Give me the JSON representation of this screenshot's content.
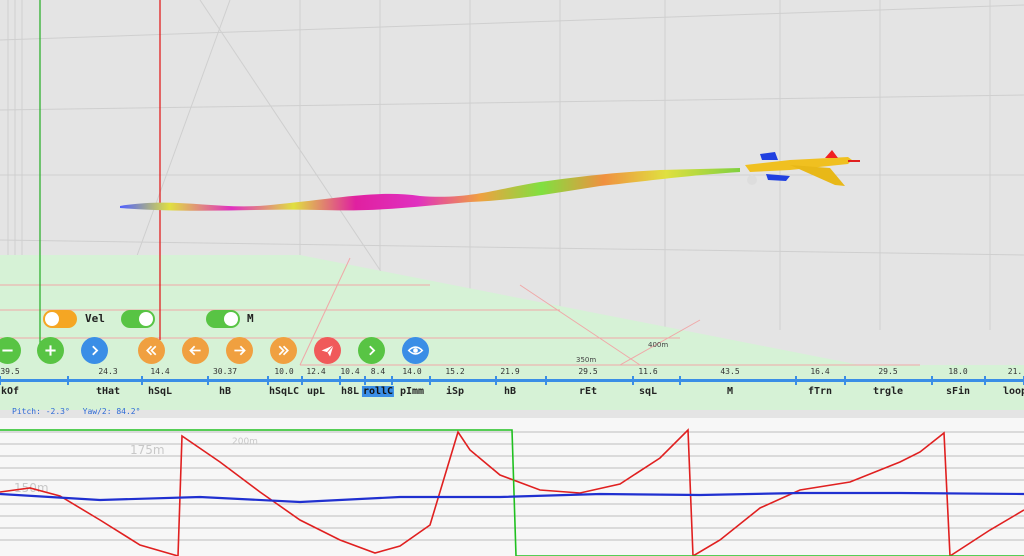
{
  "scene": {
    "distance_labels": [
      "350m",
      "400m"
    ],
    "bg_labels": [
      "175m",
      "150m",
      "200m"
    ]
  },
  "toggles": [
    {
      "name": "toggle-a",
      "label": "",
      "on": false,
      "color": "#f5a623"
    },
    {
      "name": "toggle-vel",
      "label": "Vel",
      "on": true,
      "color": "#58c444"
    },
    {
      "name": "toggle-m",
      "label": "M",
      "on": true,
      "color": "#58c444"
    }
  ],
  "controls": [
    {
      "name": "zoom-out-button",
      "icon": "minus-icon",
      "color": "#58c444"
    },
    {
      "name": "zoom-in-button",
      "icon": "plus-icon",
      "color": "#58c444"
    },
    {
      "name": "next-button",
      "icon": "chevron-right-icon",
      "color": "#3a8ee6"
    },
    {
      "name": "rewind-button",
      "icon": "double-chevron-left-icon",
      "color": "#f0a040"
    },
    {
      "name": "step-back-button",
      "icon": "arrow-left-icon",
      "color": "#f0a040"
    },
    {
      "name": "step-forward-button",
      "icon": "arrow-right-icon",
      "color": "#f0a040"
    },
    {
      "name": "fast-forward-button",
      "icon": "double-chevron-right-icon",
      "color": "#f0a040"
    },
    {
      "name": "send-button",
      "icon": "paper-plane-icon",
      "color": "#f05a5a"
    },
    {
      "name": "play-button",
      "icon": "chevron-right-icon",
      "color": "#58c444"
    },
    {
      "name": "view-button",
      "icon": "eye-icon",
      "color": "#3a8ee6"
    }
  ],
  "timeline": {
    "accent": "#3a8ee6",
    "segments": [
      {
        "name": "kOf",
        "value": "39.5"
      },
      {
        "name": "tHat",
        "value": "24.3"
      },
      {
        "name": "hSqL",
        "value": "14.4"
      },
      {
        "name": "hB",
        "value": "30.37"
      },
      {
        "name": "hSqLC",
        "value": "10.0"
      },
      {
        "name": "upL",
        "value": "12.4"
      },
      {
        "name": "h8L",
        "value": "10.4"
      },
      {
        "name": "rollC",
        "value": "8.4"
      },
      {
        "name": "pImm",
        "value": "14.0"
      },
      {
        "name": "iSp",
        "value": "15.2"
      },
      {
        "name": "hB",
        "value": "21.9"
      },
      {
        "name": "rEt",
        "value": "29.5"
      },
      {
        "name": "sqL",
        "value": "11.6"
      },
      {
        "name": "M",
        "value": "43.5"
      },
      {
        "name": "fTrn",
        "value": "16.4"
      },
      {
        "name": "trgle",
        "value": "29.5"
      },
      {
        "name": "sFin",
        "value": "18.0"
      },
      {
        "name": "loop",
        "value": "21."
      }
    ],
    "selected": 7
  },
  "status": {
    "pitch": "Pitch: -2.3°",
    "yaw": "Yaw/2: 84.2°"
  },
  "chart_data": {
    "type": "line",
    "series": [
      {
        "color": "#e02020",
        "points": [
          [
            0,
            492
          ],
          [
            30,
            488
          ],
          [
            60,
            496
          ],
          [
            100,
            520
          ],
          [
            140,
            545
          ],
          [
            178,
            556
          ],
          [
            182,
            436
          ],
          [
            220,
            462
          ],
          [
            260,
            492
          ],
          [
            300,
            520
          ],
          [
            340,
            540
          ],
          [
            375,
            553
          ],
          [
            400,
            546
          ],
          [
            430,
            525
          ],
          [
            458,
            432
          ],
          [
            470,
            450
          ],
          [
            500,
            475
          ],
          [
            540,
            490
          ],
          [
            580,
            493
          ],
          [
            620,
            484
          ],
          [
            660,
            458
          ],
          [
            688,
            430
          ],
          [
            693,
            556
          ],
          [
            720,
            540
          ],
          [
            760,
            508
          ],
          [
            800,
            490
          ],
          [
            850,
            482
          ],
          [
            900,
            462
          ],
          [
            920,
            452
          ],
          [
            944,
            433
          ],
          [
            950,
            556
          ],
          [
            990,
            530
          ],
          [
            1024,
            510
          ]
        ]
      },
      {
        "color": "#20c020",
        "points": [
          [
            0,
            430
          ],
          [
            512,
            430
          ],
          [
            516,
            556
          ],
          [
            1024,
            556
          ]
        ]
      },
      {
        "color": "#2030d0",
        "points": [
          [
            0,
            494
          ],
          [
            100,
            500
          ],
          [
            200,
            497
          ],
          [
            300,
            502
          ],
          [
            400,
            497
          ],
          [
            500,
            497
          ],
          [
            600,
            494
          ],
          [
            700,
            495
          ],
          [
            800,
            493
          ],
          [
            900,
            493
          ],
          [
            1024,
            494
          ]
        ]
      }
    ]
  }
}
